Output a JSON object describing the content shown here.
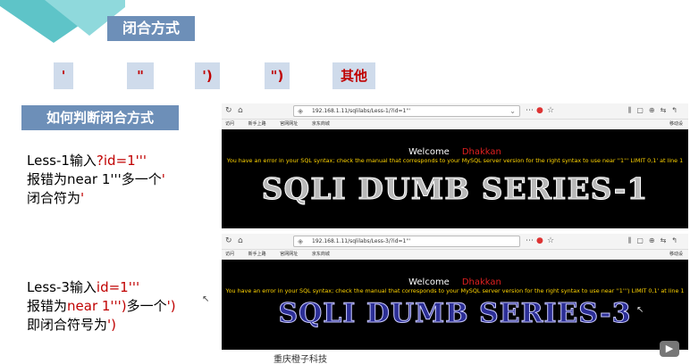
{
  "slide": {
    "title": "闭合方式",
    "options": [
      "'",
      "\"",
      "')",
      "\")",
      "其他"
    ],
    "subtitle": "如何判断闭合方式",
    "case1": {
      "line1_prefix": "Less-1输入",
      "line1_red": "?id=1'''",
      "line2_prefix": "报错为near 1'''",
      "line2_middle": "多一个",
      "line2_red": "'",
      "line3_prefix": "闭合符为",
      "line3_red": "'"
    },
    "case2": {
      "line1_prefix": "Less-3输入",
      "line1_red": "id=1'''",
      "line2_prefix": "报错为",
      "line2_red1": "near 1''')",
      "line2_middle": "多一个",
      "line2_red2": "')",
      "line3_prefix": "即闭合符号为",
      "line3_red": "')"
    },
    "footer": "重庆橙子科技"
  },
  "browser1": {
    "url": "192.168.1.11/sqlilabs/Less-1/?id=1'''",
    "bookmarks": [
      "访问",
      "新手上路",
      "官网网址",
      "京东商城"
    ],
    "mobile_bookmarks": "移动设",
    "welcome": "Welcome",
    "user": "Dhakkan",
    "error": "You have an error in your SQL syntax; check the manual that corresponds to your MySQL server version for the right syntax to use near ''1''' LIMIT 0,1' at line 1",
    "banner": "SQLI DUMB SERIES-1"
  },
  "browser2": {
    "url": "192.168.1.11/sqlilabs/Less-3/?id=1'''",
    "bookmarks": [
      "访问",
      "新手上路",
      "官网网址",
      "京东商城"
    ],
    "mobile_bookmarks": "移动设",
    "welcome": "Welcome",
    "user": "Dhakkan",
    "error": "You have an error in your SQL syntax; check the manual that corresponds to your MySQL server version for the right syntax to use near ''1''') LIMIT 0,1' at line 1",
    "banner": "SQLI DUMB SERIES-3"
  },
  "colors": {
    "title_bg": "#6d8fb8",
    "option_bg": "#cfdbeb",
    "accent_red": "#c00000",
    "teal_light": "#8fd9dc",
    "teal_dark": "#5ec4c8"
  }
}
